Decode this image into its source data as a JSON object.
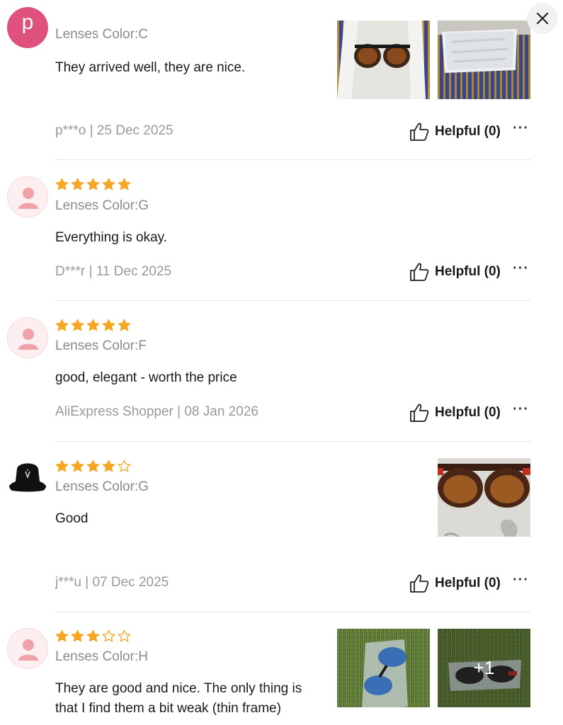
{
  "close_label": "close",
  "colors": {
    "star": "#f5a623",
    "avatar_pink": "#e0527e"
  },
  "reviews": [
    {
      "avatar_letter": "p",
      "stars": null,
      "variant": "Lenses Color:C",
      "text": "They arrived well, they are nice.",
      "meta": "p***o | 25 Dec 2025",
      "helpful": "Helpful (0)",
      "more": "···"
    },
    {
      "stars": 5,
      "variant": "Lenses Color:G",
      "text": "Everything is okay.",
      "meta": "D***r | 11 Dec 2025",
      "helpful": "Helpful (0)",
      "more": "···"
    },
    {
      "stars": 5,
      "variant": "Lenses Color:F",
      "text": "good, elegant - worth the price",
      "meta": "AliExpress Shopper | 08 Jan 2026",
      "helpful": "Helpful (0)",
      "more": "···"
    },
    {
      "stars": 4,
      "variant": "Lenses Color:G",
      "text": "Good",
      "meta": "j***u | 07 Dec 2025",
      "helpful": "Helpful (0)",
      "more": "···"
    },
    {
      "stars": 3,
      "variant": "Lenses Color:H",
      "text_line1": "They are good and nice. The only thing is",
      "text_line2": "that I find them a bit weak (thin frame)",
      "extra_photos": "+1"
    }
  ]
}
